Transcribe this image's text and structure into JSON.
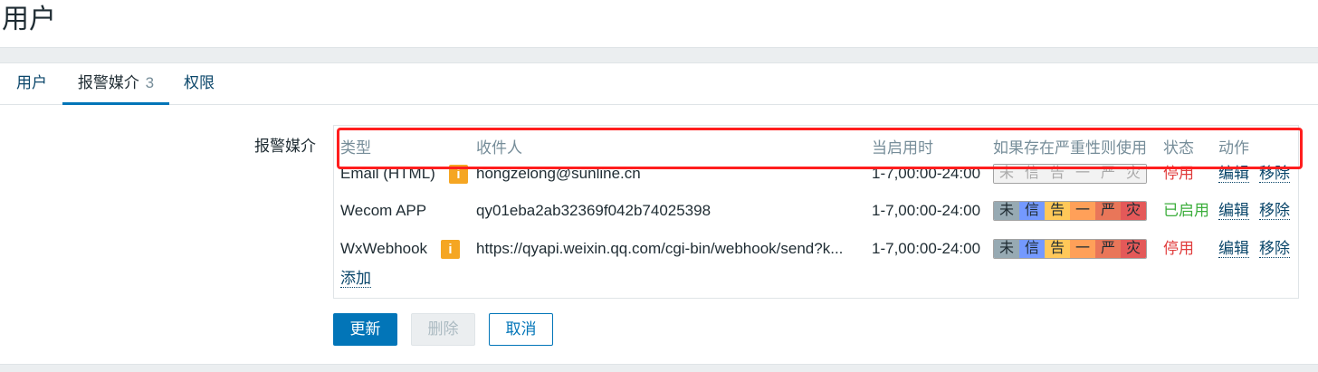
{
  "page_title": "用户",
  "tabs": [
    {
      "label": "用户",
      "count": ""
    },
    {
      "label": "报警媒介",
      "count": "3"
    },
    {
      "label": "权限",
      "count": ""
    }
  ],
  "form_label": "报警媒介",
  "table": {
    "headers": [
      "类型",
      "收件人",
      "当启用时",
      "如果存在严重性则使用",
      "状态",
      "动作"
    ],
    "rows": [
      {
        "type": "Email (HTML)",
        "info": "i",
        "recipient": "hongzelong@sunline.cn",
        "when_active": "1-7,00:00-24:00",
        "severity_state": "none",
        "status": "停用",
        "edit": "编辑",
        "remove": "移除"
      },
      {
        "type": "Wecom APP",
        "info": "",
        "recipient": "qy01eba2ab32369f042b74025398",
        "when_active": "1-7,00:00-24:00",
        "severity_state": "all",
        "status": "已启用",
        "edit": "编辑",
        "remove": "移除"
      },
      {
        "type": "WxWebhook",
        "info": "i",
        "recipient": "https://qyapi.weixin.qq.com/cgi-bin/webhook/send?k...",
        "when_active": "1-7,00:00-24:00",
        "severity_state": "all",
        "status": "停用",
        "edit": "编辑",
        "remove": "移除"
      }
    ],
    "severities": [
      "未",
      "信",
      "告",
      "一",
      "严",
      "灾"
    ],
    "add_link": "添加"
  },
  "buttons": {
    "update": "更新",
    "delete": "删除",
    "cancel": "取消"
  },
  "colors": {
    "accent": "#0275b8",
    "highlight": "#ff1e1e",
    "status_off": "#e03c3c",
    "status_on": "#3cae3c"
  }
}
